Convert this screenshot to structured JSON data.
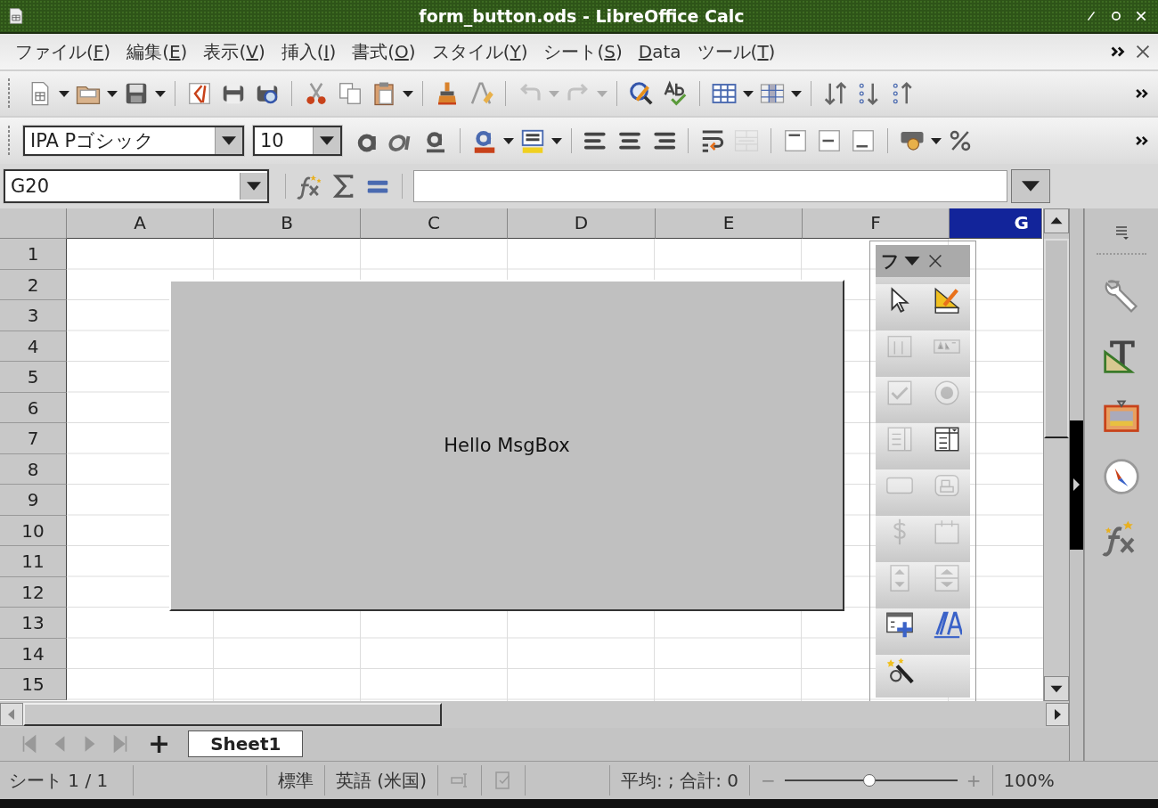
{
  "window": {
    "title": "form_button.ods - LibreOffice Calc"
  },
  "menu": [
    {
      "text": "ファイル(",
      "accel": "F",
      "tail": ")"
    },
    {
      "text": "編集(",
      "accel": "E",
      "tail": ")"
    },
    {
      "text": "表示(",
      "accel": "V",
      "tail": ")"
    },
    {
      "text": "挿入(",
      "accel": "I",
      "tail": ")"
    },
    {
      "text": "書式(",
      "accel": "O",
      "tail": ")"
    },
    {
      "text": "スタイル(",
      "accel": "Y",
      "tail": ")"
    },
    {
      "text": "シート(",
      "accel": "S",
      "tail": ")"
    },
    {
      "accel": "D",
      "tail": "ata"
    },
    {
      "text": "ツール(",
      "accel": "T",
      "tail": ")"
    }
  ],
  "standard_toolbar": {
    "undo": {
      "disabled": true
    },
    "redo": {
      "disabled": true
    }
  },
  "formatting_toolbar": {
    "font_name": "IPA Pゴシック",
    "font_size": "10",
    "merge": {
      "disabled": true
    }
  },
  "formula_bar": {
    "name_box": "G20"
  },
  "sheet": {
    "columns": [
      {
        "label": "A",
        "selected": false
      },
      {
        "label": "B",
        "selected": false
      },
      {
        "label": "C",
        "selected": false
      },
      {
        "label": "D",
        "selected": false
      },
      {
        "label": "E",
        "selected": false
      },
      {
        "label": "F",
        "selected": false
      },
      {
        "label": "G",
        "selected": true
      }
    ],
    "rows": [
      "1",
      "2",
      "3",
      "4",
      "5",
      "6",
      "7",
      "8",
      "9",
      "10",
      "11",
      "12",
      "13",
      "14",
      "15"
    ],
    "form_button": {
      "label": "Hello MsgBox"
    }
  },
  "form_toolbar": {
    "title": "フ",
    "controls": [
      {
        "disabled": false
      },
      {
        "disabled": false
      },
      {
        "disabled": true
      },
      {
        "disabled": true
      },
      {
        "disabled": true
      },
      {
        "disabled": true
      },
      {
        "disabled": true
      },
      {
        "disabled": false
      },
      {
        "disabled": true
      },
      {
        "disabled": true
      },
      {
        "disabled": true
      },
      {
        "disabled": true
      },
      {
        "disabled": true
      },
      {
        "disabled": true
      },
      {
        "disabled": false
      },
      {
        "disabled": false
      },
      {
        "disabled": false
      }
    ]
  },
  "sheet_tabs": {
    "add": "+",
    "tabs": [
      {
        "label": "Sheet1",
        "selected": true
      }
    ]
  },
  "status_bar": {
    "sheet": "シート 1 / 1",
    "page_style": "標準",
    "language": "英語 (米国)",
    "summary": "平均: ; 合計: 0",
    "zoom_out": "−",
    "zoom_in": "+",
    "zoom": {
      "level": 0.49
    },
    "zoom_value": "100%"
  }
}
